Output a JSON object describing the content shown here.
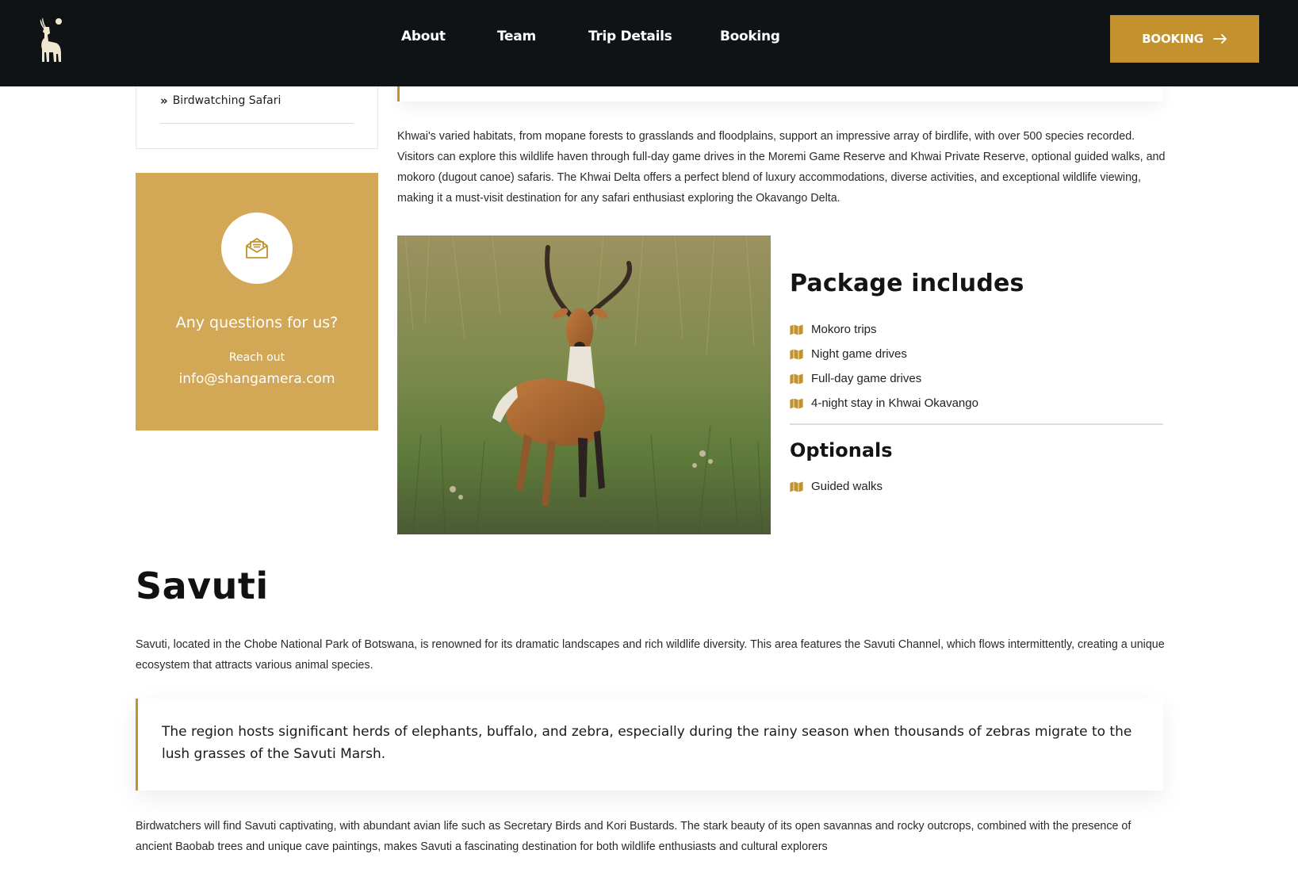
{
  "header": {
    "nav": [
      "About",
      "Team",
      "Trip Details",
      "Booking"
    ],
    "cta_label": "BOOKING"
  },
  "sidebar": {
    "link_label": "Birdwatching Safari",
    "contact": {
      "title": "Any questions for us?",
      "subtitle": "Reach out",
      "email": "info@shangamera.com"
    }
  },
  "khwai": {
    "paragraph": "Khwai's varied habitats, from mopane forests to grasslands and floodplains, support an impressive array of birdlife, with over 500 species recorded. Visitors can explore this wildlife haven through full-day game drives in the Moremi Game Reserve and Khwai Private Reserve, optional guided walks, and mokoro (dugout canoe) safaris. The Khwai Delta offers a perfect blend of luxury accommodations, diverse activities, and exceptional wildlife viewing, making it a must-visit destination for any safari enthusiast exploring the Okavango Delta."
  },
  "package": {
    "title": "Package includes",
    "items": [
      "Mokoro trips",
      "Night game drives",
      "Full-day game drives",
      "4-night stay in Khwai Okavango"
    ],
    "optionals_title": "Optionals",
    "optionals": [
      "Guided walks"
    ]
  },
  "savuti": {
    "title": "Savuti",
    "paragraph1": "Savuti, located in the Chobe National Park of Botswana, is renowned for its dramatic landscapes and rich wildlife diversity. This area features the Savuti Channel, which flows intermittently, creating a unique ecosystem that attracts various animal species.",
    "quote": "The region hosts significant herds of elephants, buffalo, and zebra, especially during the rainy season when thousands of zebras migrate to the lush grasses of the Savuti Marsh.",
    "paragraph2": "Birdwatchers will find Savuti captivating, with abundant avian life such as Secretary Birds and Kori Bustards. The stark beauty of its open savannas and rocky outcrops, combined with the presence of ancient Baobab trees and unique cave paintings, makes Savuti a fascinating destination for both wildlife enthusiasts and cultural explorers"
  },
  "colors": {
    "header_bg": "#0f1316",
    "accent": "#c3922e",
    "contact_bg": "#d2a755"
  }
}
